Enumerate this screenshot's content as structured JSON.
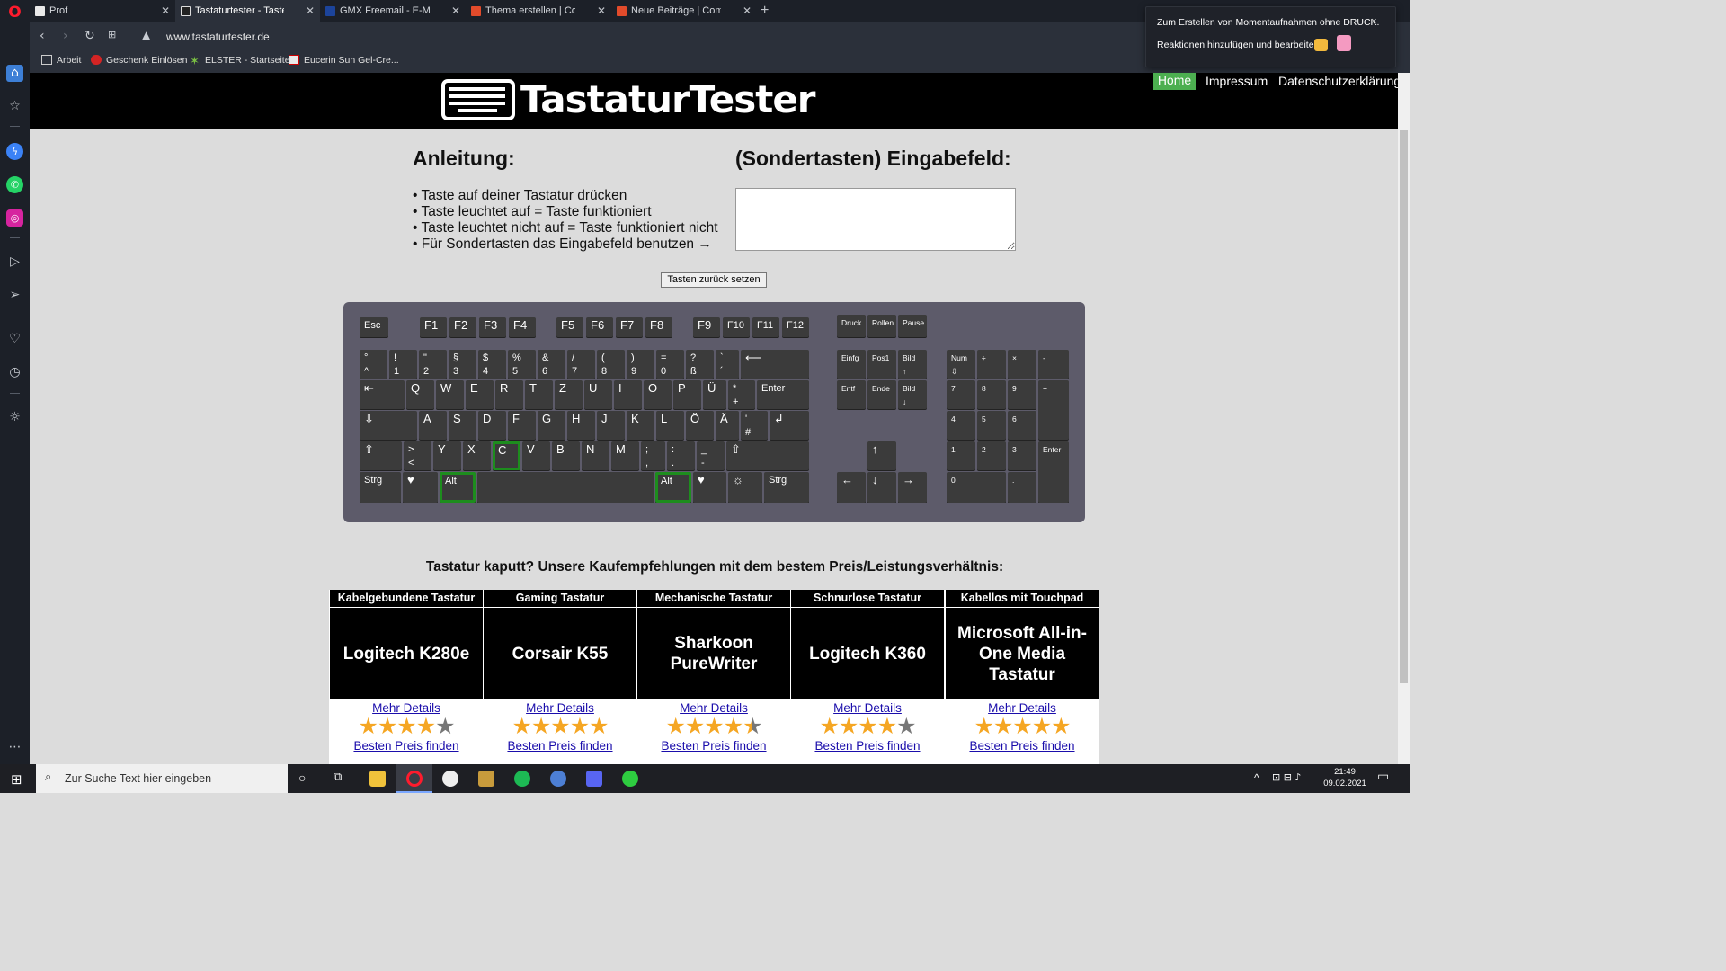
{
  "browser": {
    "tabs": [
      {
        "label": "Prof",
        "active": false
      },
      {
        "label": "Tastaturtester - Tasten teste",
        "active": true
      },
      {
        "label": "GMX Freemail - E-Mail mac",
        "active": false
      },
      {
        "label": "Thema erstellen | Compute",
        "active": false
      },
      {
        "label": "Neue Beiträge | ComputerB",
        "active": false
      }
    ],
    "new_tab": "+",
    "url": "www.tastaturtester.de",
    "bookmarks": [
      "Arbeit",
      "Geschenk Einlösen",
      "ELSTER - Startseite",
      "Eucerin Sun Gel-Cre..."
    ],
    "toast": {
      "line1": "Zum Erstellen von Momentaufnahmen ohne DRUCK.",
      "line2": "Reaktionen hinzufügen und bearbeiten",
      "close": "×"
    }
  },
  "site": {
    "logo_text": "TastaturTester",
    "nav": [
      "Home",
      "Impressum",
      "Datenschutzerklärung"
    ],
    "instructions_title": "Anleitung:",
    "instructions": [
      "• Taste auf deiner Tastatur drücken",
      "• Taste leuchtet auf = Taste funktioniert",
      "• Taste leuchtet nicht auf = Taste funktioniert nicht",
      "• Für Sondertasten das Eingabefeld benutzen →"
    ],
    "input_title": "(Sondertasten) Eingabefeld:",
    "reset_button": "Tasten zurück setzen",
    "rec_title": "Tastatur kaputt? Unsere Kaufempfehlungen mit dem bestem Preis/Leistungsverhältnis:",
    "recommendations": [
      {
        "category": "Kabelgebundene Tastatur",
        "product": "Logitech K280e",
        "details": "Mehr Details",
        "stars": 4,
        "price": "Besten Preis finden"
      },
      {
        "category": "Gaming Tastatur",
        "product": "Corsair K55",
        "details": "Mehr Details",
        "stars": 5,
        "price": "Besten Preis finden"
      },
      {
        "category": "Mechanische Tastatur",
        "product": "Sharkoon PureWriter",
        "details": "Mehr Details",
        "stars": 4.5,
        "price": "Besten Preis finden"
      },
      {
        "category": "Schnurlose Tastatur",
        "product": "Logitech K360",
        "details": "Mehr Details",
        "stars": 4,
        "price": "Besten Preis finden"
      },
      {
        "category": "Kabellos mit Touchpad",
        "product": "Microsoft All-in-One Media Tastatur",
        "details": "Mehr Details",
        "stars": 5,
        "price": "Besten Preis finden"
      }
    ]
  },
  "keyboard": {
    "lit_keys": [
      "C",
      "Alt",
      "AltGr"
    ],
    "lit_color": "#1d8d1d"
  },
  "taskbar": {
    "search_placeholder": "Zur Suche Text hier eingeben",
    "time": "21:49",
    "date": "09.02.2021"
  },
  "colors": {
    "accent_green": "#4caf50",
    "link": "#1a0dab",
    "star": "#f5a623",
    "star_off": "#777777"
  }
}
